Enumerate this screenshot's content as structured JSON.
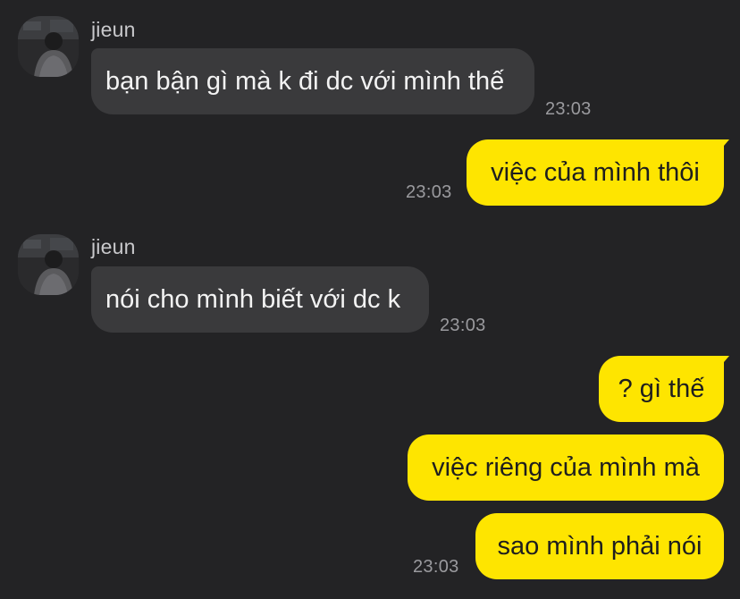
{
  "theme": {
    "background": "#232325",
    "incoming_bubble": "#3a3a3c",
    "outgoing_bubble": "#fee500"
  },
  "messages": [
    {
      "direction": "incoming",
      "sender": "jieun",
      "avatar_icon": "profile-photo-icon",
      "text": "bạn bận gì mà k đi dc với mình thế",
      "time": "23:03"
    },
    {
      "direction": "outgoing",
      "text": "việc của mình thôi",
      "time": "23:03"
    },
    {
      "direction": "incoming",
      "sender": "jieun",
      "avatar_icon": "profile-photo-icon",
      "text": "nói cho mình biết với dc k",
      "time": "23:03"
    },
    {
      "direction": "outgoing",
      "text": "? gì thế"
    },
    {
      "direction": "outgoing",
      "text": "việc riêng của mình mà"
    },
    {
      "direction": "outgoing",
      "text": "sao mình phải nói",
      "time": "23:03"
    }
  ]
}
